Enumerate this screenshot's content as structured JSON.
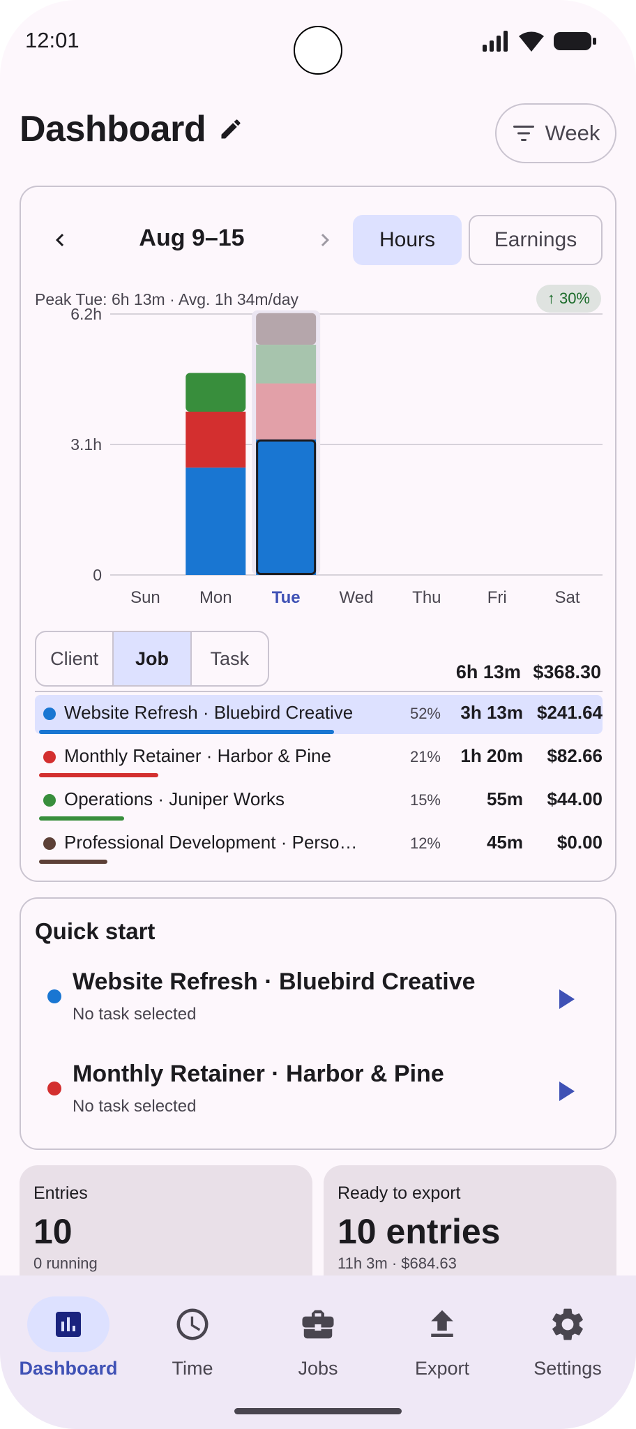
{
  "status_bar": {
    "time": "12:01"
  },
  "header": {
    "title": "Dashboard",
    "filter_label": "Week"
  },
  "chart_card": {
    "range_label": "Aug 9–15",
    "metric_tabs": [
      "Hours",
      "Earnings"
    ],
    "selected_metric": "Hours",
    "peak_text": "Peak Tue: 6h 13m · Avg. 1h 34m/day",
    "trend_badge": "↑ 30%",
    "dimension_tabs": [
      "Client",
      "Job",
      "Task"
    ],
    "selected_dimension": "Job",
    "total_time": "6h 13m",
    "total_earnings": "$368.30"
  },
  "chart_data": {
    "type": "bar",
    "stacked": true,
    "categories": [
      "Sun",
      "Mon",
      "Tue",
      "Wed",
      "Thu",
      "Fri",
      "Sat"
    ],
    "selected_category": "Tue",
    "y_ticks": [
      "6.2h",
      "3.1h",
      "0"
    ],
    "ylim": [
      0,
      6.2
    ],
    "grid": true,
    "series": [
      {
        "name": "Website Refresh · Bluebird Creative",
        "color": "#1976d2",
        "values": [
          0,
          2.55,
          3.22,
          0,
          0,
          0,
          0
        ]
      },
      {
        "name": "Monthly Retainer · Harbor & Pine",
        "color": "#d32f2f",
        "values": [
          0,
          1.33,
          1.33,
          0,
          0,
          0,
          0
        ]
      },
      {
        "name": "Operations · Juniper Works",
        "color": "#388e3c",
        "values": [
          0,
          0.92,
          0.92,
          0,
          0,
          0,
          0
        ]
      },
      {
        "name": "Professional Development · Personal",
        "color": "#5d4037",
        "values": [
          0,
          0,
          0.75,
          0,
          0,
          0,
          0
        ]
      }
    ]
  },
  "legend_rows": [
    {
      "name": "Website Refresh · Bluebird Creative",
      "pct": "52%",
      "time": "3h 13m",
      "earnings": "$241.64",
      "color": "#1976d2",
      "share": 0.52,
      "selected": true
    },
    {
      "name": "Monthly Retainer · Harbor & Pine",
      "pct": "21%",
      "time": "1h 20m",
      "earnings": "$82.66",
      "color": "#d32f2f",
      "share": 0.21
    },
    {
      "name": "Operations · Juniper Works",
      "pct": "15%",
      "time": "55m",
      "earnings": "$44.00",
      "color": "#388e3c",
      "share": 0.15
    },
    {
      "name": "Professional Development · Perso…",
      "pct": "12%",
      "time": "45m",
      "earnings": "$0.00",
      "color": "#5d4037",
      "share": 0.12
    }
  ],
  "quick_start": {
    "title": "Quick start",
    "items": [
      {
        "name": "Website Refresh · Bluebird Creative",
        "sub": "No task selected",
        "color": "#1976d2"
      },
      {
        "name": "Monthly Retainer · Harbor & Pine",
        "sub": "No task selected",
        "color": "#d32f2f"
      }
    ]
  },
  "stats": {
    "entries_label": "Entries",
    "entries_value": "10",
    "entries_sub": "0 running",
    "export_label": "Ready to export",
    "export_value": "10 entries",
    "export_sub": "11h 3m · $684.63"
  },
  "bottom_nav": {
    "items": [
      {
        "label": "Dashboard",
        "icon": "bar-chart-icon"
      },
      {
        "label": "Time",
        "icon": "clock-icon"
      },
      {
        "label": "Jobs",
        "icon": "briefcase-icon"
      },
      {
        "label": "Export",
        "icon": "upload-icon"
      },
      {
        "label": "Settings",
        "icon": "gear-icon"
      }
    ],
    "active": "Dashboard"
  },
  "colors": {
    "accent": "#3f51b5",
    "accent_container": "#dde1ff",
    "background": "#fdf7fc"
  }
}
